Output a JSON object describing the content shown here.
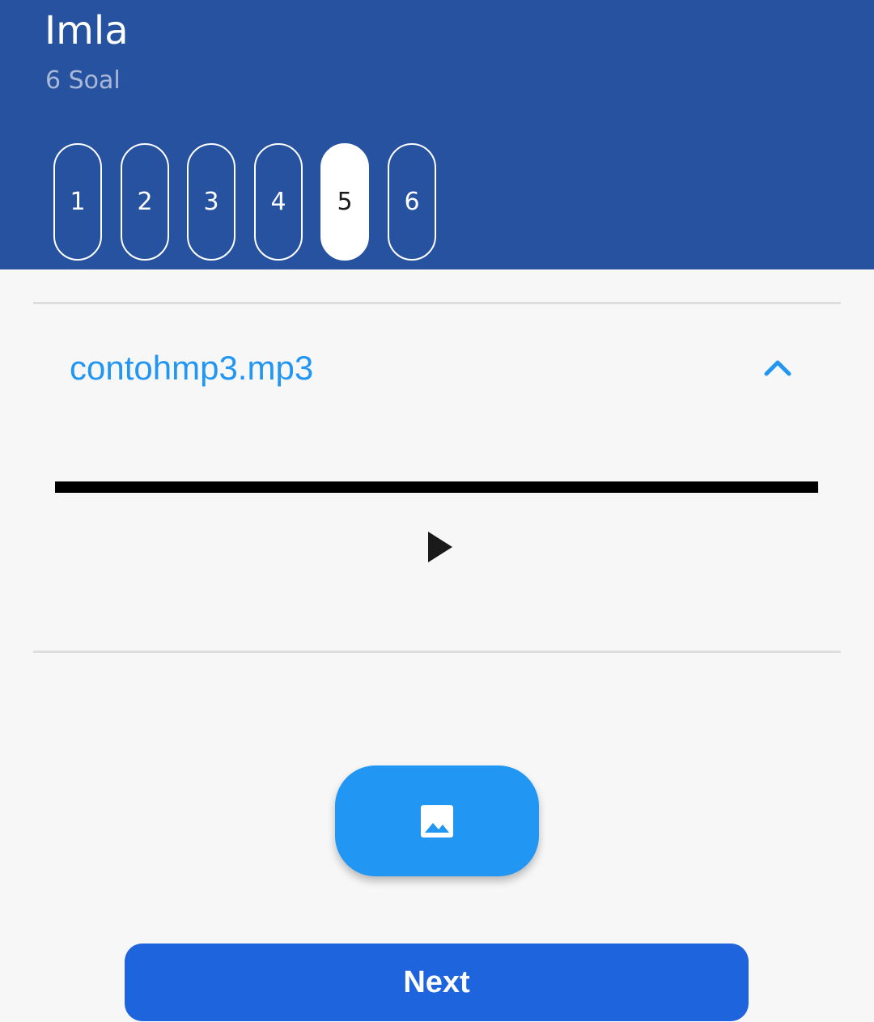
{
  "header": {
    "title": "Imla",
    "subtitle": "6 Soal",
    "color": "#2652a0"
  },
  "questions": {
    "items": [
      "1",
      "2",
      "3",
      "4",
      "5",
      "6"
    ],
    "active": "5"
  },
  "audio": {
    "file_name": "contohmp3.mp3",
    "accent_color": "#2196f3",
    "play_icon": "play-icon",
    "collapse_icon": "chevron-up-icon"
  },
  "actions": {
    "image_icon": "image-icon",
    "next_label": "Next",
    "next_color": "#1e64dc"
  }
}
